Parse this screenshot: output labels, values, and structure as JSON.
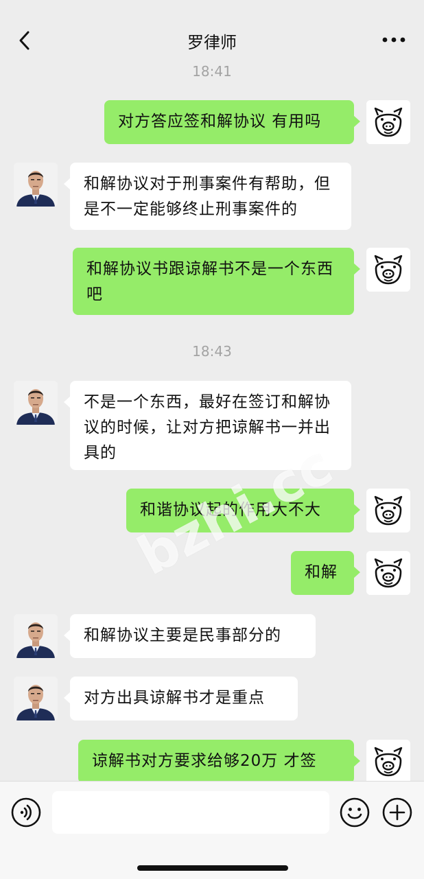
{
  "header": {
    "title": "罗律师"
  },
  "messages": {
    "t1": "18:41",
    "m1": "对方答应签和解协议 有用吗",
    "m2": "和解协议对于刑事案件有帮助，但是不一定能够终止刑事案件的",
    "m3": "和解协议书跟谅解书不是一个东西吧",
    "t2": "18:43",
    "m4": "不是一个东西，最好在签订和解协议的时候，让对方把谅解书一并出具的",
    "m5": "和谐协议起的作用大不大",
    "m6": "和解",
    "m7": "和解协议主要是民事部分的",
    "m8": "对方出具谅解书才是重点",
    "m9": "谅解书对方要求给够20万 才签"
  },
  "watermark": "bzhi.cc",
  "input": {
    "value": ""
  },
  "colors": {
    "sent_bubble": "#95ec69",
    "received_bubble": "#ffffff",
    "background": "#ededed"
  },
  "icons": {
    "back": "chevron-left-icon",
    "more": "more-dots-icon",
    "voice": "voice-icon",
    "emoji": "emoji-icon",
    "plus": "plus-icon"
  }
}
